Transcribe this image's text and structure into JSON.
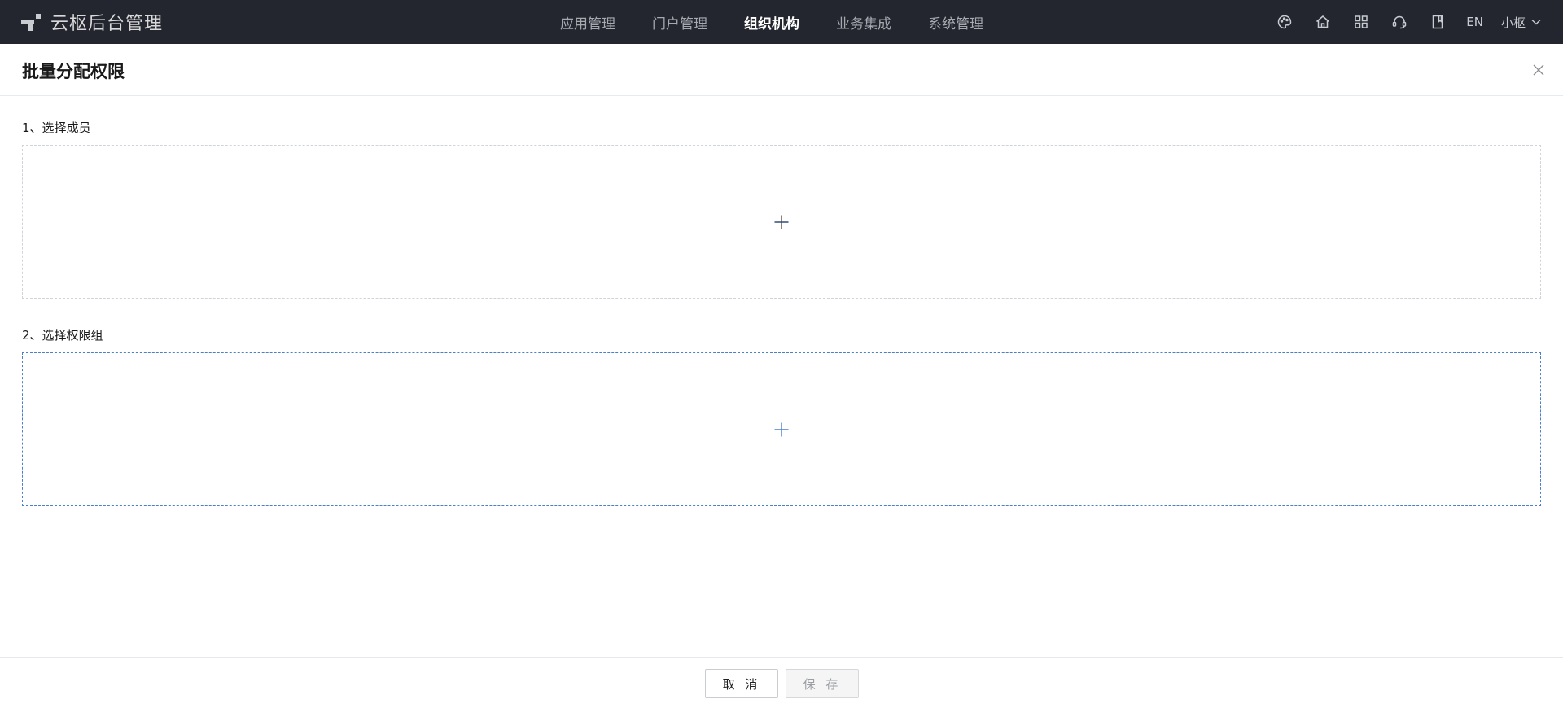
{
  "app": {
    "title": "云枢后台管理",
    "logo_icon": "yunshu-logo-icon"
  },
  "nav": {
    "items": [
      {
        "label": "应用管理",
        "active": false
      },
      {
        "label": "门户管理",
        "active": false
      },
      {
        "label": "组织机构",
        "active": true
      },
      {
        "label": "业务集成",
        "active": false
      },
      {
        "label": "系统管理",
        "active": false
      }
    ]
  },
  "toolbar": {
    "icons": [
      "palette-icon",
      "home-icon",
      "apps-grid-icon",
      "headset-icon",
      "book-icon"
    ],
    "lang": "EN",
    "user": "小枢"
  },
  "dialog": {
    "title": "批量分配权限",
    "section_members_label": "1、选择成员",
    "section_groups_label": "2、选择权限组",
    "cancel_label": "取 消",
    "save_label": "保 存"
  },
  "colors": {
    "topbar_bg": "#23262e",
    "accent_blue": "#4a7fcb",
    "border_gray": "#d0d4da"
  }
}
